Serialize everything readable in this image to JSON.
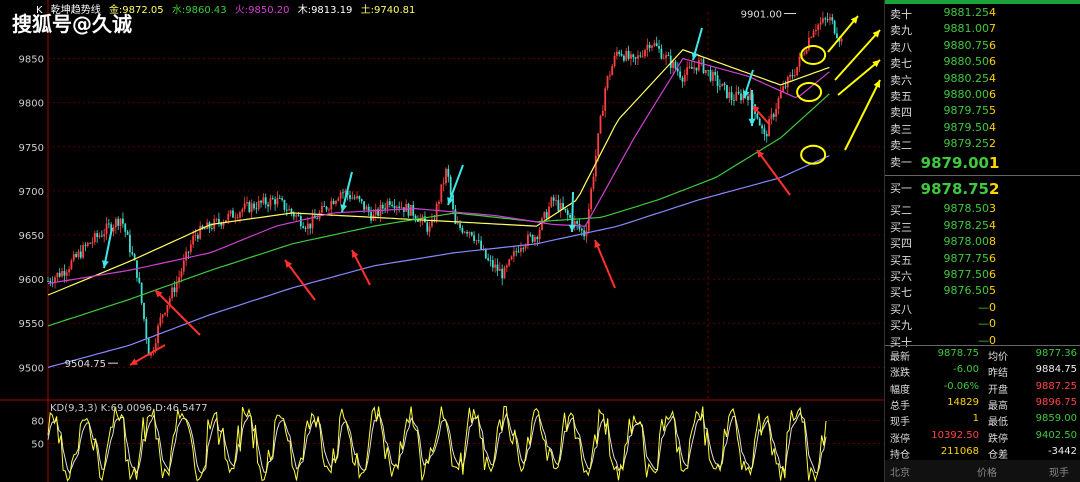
{
  "watermark": "搜狐号@久诚",
  "legend": {
    "k": "K",
    "name": "乾坤趋势线",
    "jin": "金:9872.05",
    "shui": "水:9860.43",
    "huo": "火:9850.20",
    "mu": "木:9813.19",
    "tu": "土:9740.81",
    "colors": {
      "k": "#ffffff",
      "name": "#ffffff",
      "jin": "#ffff66",
      "shui": "#3ec93e",
      "huo": "#d040d0",
      "mu": "#ffffff",
      "tu": "#ffff66"
    }
  },
  "kd_label": "KD(9,3,3)  K:69.0096  D:46.5477",
  "chart_data": {
    "type": "candlestick",
    "ylim": [
      9480,
      9905
    ],
    "price_ticks": [
      9850,
      9800,
      9750,
      9700,
      9650,
      9600,
      9550,
      9500
    ],
    "kd_ticks": [
      80,
      50
    ],
    "annotations": {
      "high": "9901.00",
      "low": "9504.75"
    },
    "ma_lines": [
      {
        "name": "金",
        "color": "#ffff66",
        "anchors": [
          [
            0,
            9582
          ],
          [
            0.1,
            9620
          ],
          [
            0.2,
            9662
          ],
          [
            0.3,
            9675
          ],
          [
            0.4,
            9670
          ],
          [
            0.5,
            9665
          ],
          [
            0.6,
            9660
          ],
          [
            0.65,
            9690
          ],
          [
            0.7,
            9780
          ],
          [
            0.78,
            9860
          ],
          [
            0.84,
            9840
          ],
          [
            0.9,
            9820
          ],
          [
            0.96,
            9840
          ]
        ]
      },
      {
        "name": "水",
        "color": "#3ec93e",
        "anchors": [
          [
            0,
            9547
          ],
          [
            0.1,
            9577
          ],
          [
            0.2,
            9610
          ],
          [
            0.3,
            9640
          ],
          [
            0.4,
            9660
          ],
          [
            0.5,
            9675
          ],
          [
            0.6,
            9665
          ],
          [
            0.68,
            9670
          ],
          [
            0.75,
            9690
          ],
          [
            0.82,
            9715
          ],
          [
            0.9,
            9760
          ],
          [
            0.96,
            9810
          ]
        ]
      },
      {
        "name": "火",
        "color": "#d040d0",
        "anchors": [
          [
            0,
            9595
          ],
          [
            0.1,
            9610
          ],
          [
            0.2,
            9630
          ],
          [
            0.28,
            9660
          ],
          [
            0.35,
            9675
          ],
          [
            0.45,
            9680
          ],
          [
            0.55,
            9672
          ],
          [
            0.62,
            9662
          ],
          [
            0.66,
            9660
          ],
          [
            0.72,
            9760
          ],
          [
            0.78,
            9850
          ],
          [
            0.86,
            9830
          ],
          [
            0.92,
            9805
          ],
          [
            0.96,
            9835
          ]
        ]
      },
      {
        "name": "土",
        "color": "#8888ff",
        "anchors": [
          [
            0,
            9500
          ],
          [
            0.1,
            9525
          ],
          [
            0.2,
            9560
          ],
          [
            0.3,
            9590
          ],
          [
            0.4,
            9615
          ],
          [
            0.5,
            9630
          ],
          [
            0.6,
            9640
          ],
          [
            0.7,
            9660
          ],
          [
            0.8,
            9690
          ],
          [
            0.9,
            9715
          ],
          [
            0.96,
            9740
          ]
        ]
      }
    ],
    "price_path": [
      [
        0,
        9598
      ],
      [
        0.02,
        9610
      ],
      [
        0.05,
        9640
      ],
      [
        0.09,
        9670
      ],
      [
        0.11,
        9605
      ],
      [
        0.125,
        9510
      ],
      [
        0.14,
        9560
      ],
      [
        0.16,
        9600
      ],
      [
        0.18,
        9650
      ],
      [
        0.2,
        9660
      ],
      [
        0.24,
        9680
      ],
      [
        0.28,
        9690
      ],
      [
        0.32,
        9660
      ],
      [
        0.36,
        9700
      ],
      [
        0.38,
        9690
      ],
      [
        0.4,
        9670
      ],
      [
        0.42,
        9690
      ],
      [
        0.45,
        9675
      ],
      [
        0.47,
        9655
      ],
      [
        0.49,
        9725
      ],
      [
        0.5,
        9660
      ],
      [
        0.52,
        9655
      ],
      [
        0.54,
        9620
      ],
      [
        0.56,
        9605
      ],
      [
        0.58,
        9640
      ],
      [
        0.6,
        9650
      ],
      [
        0.62,
        9690
      ],
      [
        0.64,
        9670
      ],
      [
        0.66,
        9650
      ],
      [
        0.67,
        9720
      ],
      [
        0.685,
        9820
      ],
      [
        0.7,
        9860
      ],
      [
        0.72,
        9845
      ],
      [
        0.74,
        9870
      ],
      [
        0.76,
        9850
      ],
      [
        0.78,
        9830
      ],
      [
        0.8,
        9845
      ],
      [
        0.82,
        9825
      ],
      [
        0.84,
        9805
      ],
      [
        0.86,
        9810
      ],
      [
        0.87,
        9790
      ],
      [
        0.88,
        9760
      ],
      [
        0.9,
        9810
      ],
      [
        0.92,
        9840
      ],
      [
        0.94,
        9885
      ],
      [
        0.96,
        9895
      ],
      [
        0.975,
        9870
      ]
    ],
    "circles": [
      [
        0.94,
        9854
      ],
      [
        0.935,
        9812
      ],
      [
        0.94,
        9741
      ]
    ]
  },
  "order_book": {
    "sell": [
      {
        "label": "卖十",
        "price": "9881.25",
        "vol": "4"
      },
      {
        "label": "卖九",
        "price": "9881.00",
        "vol": "7"
      },
      {
        "label": "卖八",
        "price": "9880.75",
        "vol": "6"
      },
      {
        "label": "卖七",
        "price": "9880.50",
        "vol": "6"
      },
      {
        "label": "卖六",
        "price": "9880.25",
        "vol": "4"
      },
      {
        "label": "卖五",
        "price": "9880.00",
        "vol": "6"
      },
      {
        "label": "卖四",
        "price": "9879.75",
        "vol": "5"
      },
      {
        "label": "卖三",
        "price": "9879.50",
        "vol": "4"
      },
      {
        "label": "卖二",
        "price": "9879.25",
        "vol": "2"
      },
      {
        "label": "卖一",
        "price": "9879.00",
        "vol": "1"
      }
    ],
    "buy": [
      {
        "label": "买一",
        "price": "9878.75",
        "vol": "2"
      },
      {
        "label": "买二",
        "price": "9878.50",
        "vol": "3"
      },
      {
        "label": "买三",
        "price": "9878.25",
        "vol": "4"
      },
      {
        "label": "买四",
        "price": "9878.00",
        "vol": "8"
      },
      {
        "label": "买五",
        "price": "9877.75",
        "vol": "6"
      },
      {
        "label": "买六",
        "price": "9877.50",
        "vol": "6"
      },
      {
        "label": "买七",
        "price": "9876.50",
        "vol": "5"
      },
      {
        "label": "买八",
        "price": "—",
        "vol": "0"
      },
      {
        "label": "买九",
        "price": "—",
        "vol": "0"
      },
      {
        "label": "买十",
        "price": "—",
        "vol": "0"
      }
    ]
  },
  "stats": [
    {
      "k1": "最新",
      "v1": "9878.75",
      "c1": "g",
      "k2": "均价",
      "v2": "9877.36",
      "c2": "g"
    },
    {
      "k1": "涨跌",
      "v1": "-6.00",
      "c1": "g",
      "k2": "昨结",
      "v2": "9884.75",
      "c2": "w"
    },
    {
      "k1": "幅度",
      "v1": "-0.06%",
      "c1": "g",
      "k2": "开盘",
      "v2": "9887.25",
      "c2": "r"
    },
    {
      "k1": "总手",
      "v1": "14829",
      "c1": "y",
      "k2": "最高",
      "v2": "9896.75",
      "c2": "r"
    },
    {
      "k1": "现手",
      "v1": "1",
      "c1": "y",
      "k2": "最低",
      "v2": "9859.00",
      "c2": "g"
    },
    {
      "k1": "涨停",
      "v1": "10392.50",
      "c1": "r",
      "k2": "跌停",
      "v2": "9402.50",
      "c2": "g"
    },
    {
      "k1": "持仓",
      "v1": "211068",
      "c1": "y",
      "k2": "仓差",
      "v2": "-3442",
      "c2": "w"
    }
  ],
  "footer": {
    "place": "北京",
    "price": "价格",
    "vol": "现手"
  }
}
